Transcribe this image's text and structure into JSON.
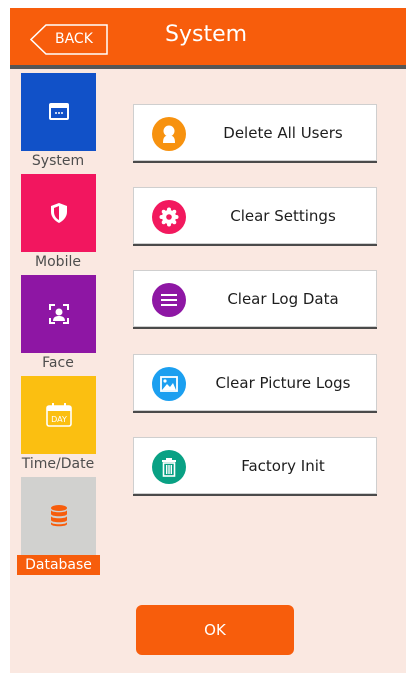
{
  "header": {
    "back_label": "BACK",
    "title": "System"
  },
  "colors": {
    "accent": "#f75d0c",
    "screen_bg": "#fae8e1"
  },
  "sidebar": {
    "items": [
      {
        "label": "System",
        "icon": "window-icon",
        "color": "#1151c8",
        "active": false
      },
      {
        "label": "Mobile",
        "icon": "shield-icon",
        "color": "#f2165f",
        "active": false
      },
      {
        "label": "Face",
        "icon": "face-scan-icon",
        "color": "#8e16a4",
        "active": false
      },
      {
        "label": "Time/Date",
        "icon": "calendar-icon",
        "color": "#fbbf11",
        "active": false
      },
      {
        "label": "Database",
        "icon": "database-icon",
        "color": "#d1d1cf",
        "active": true
      }
    ],
    "calendar_text": "DAY"
  },
  "actions": [
    {
      "label": "Delete All Users",
      "icon": "user-icon",
      "color": "#f7920f"
    },
    {
      "label": "Clear Settings",
      "icon": "gear-icon",
      "color": "#f2195e"
    },
    {
      "label": "Clear Log Data",
      "icon": "list-icon",
      "color": "#8e17a4"
    },
    {
      "label": "Clear Picture Logs",
      "icon": "image-icon",
      "color": "#1b9ff0"
    },
    {
      "label": "Factory Init",
      "icon": "trash-icon",
      "color": "#09a184"
    }
  ],
  "footer": {
    "ok_label": "OK"
  }
}
